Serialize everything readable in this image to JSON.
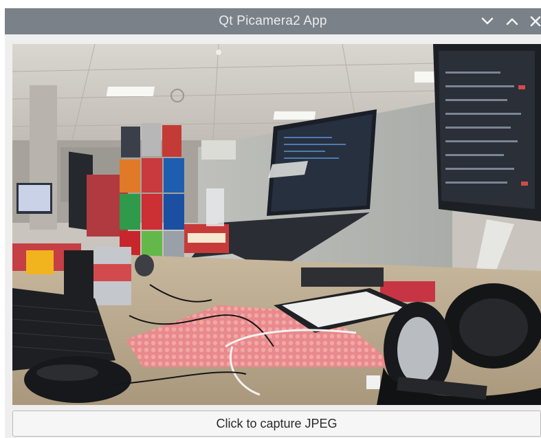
{
  "window": {
    "title": "Qt Picamera2 App",
    "titlebar_color": "#7b8189",
    "controls": {
      "minimize_icon": "chevron-down",
      "maximize_icon": "chevron-up",
      "close_icon": "x"
    }
  },
  "camera_preview": {
    "scene": "office desk with laptop on stand, stacked soda cans, monitor, keyboard, mouse, headphones and bubble wrap"
  },
  "capture_button": {
    "label": "Click to capture JPEG"
  }
}
